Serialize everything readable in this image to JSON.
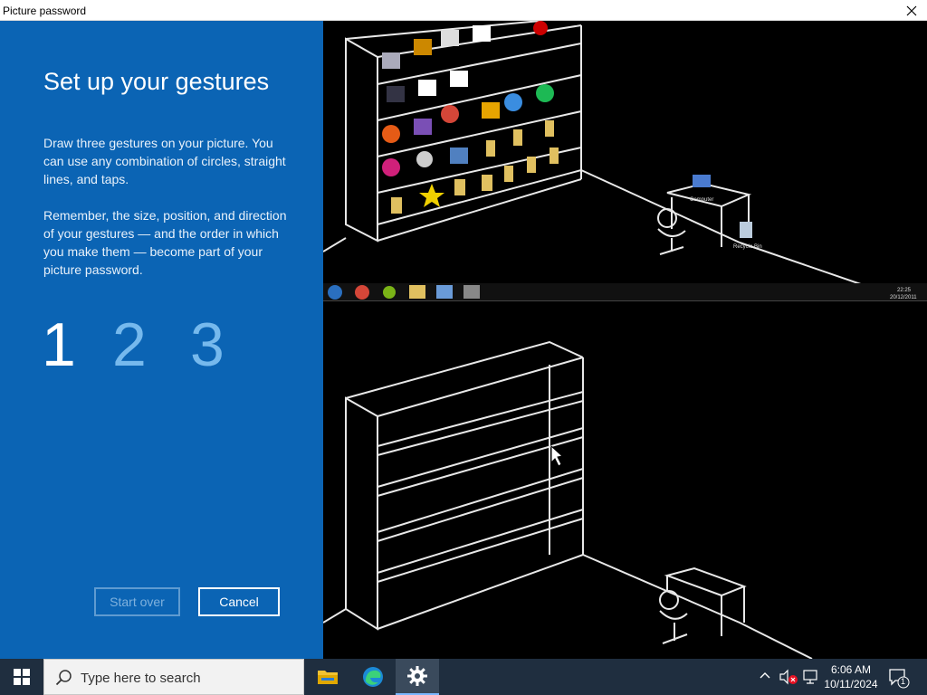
{
  "window": {
    "title": "Picture password"
  },
  "panel": {
    "heading": "Set up your gestures",
    "paragraph1": "Draw three gestures on your picture. You can use any combination of circles, straight lines, and taps.",
    "paragraph2": "Remember, the size, position, and direction of your gestures — and the order in which you make them — become part of your picture password.",
    "steps": [
      "1",
      "2",
      "3"
    ],
    "start_over_label": "Start over",
    "cancel_label": "Cancel"
  },
  "picture": {
    "top_labels": {
      "computer": "Computer",
      "recycle_bin": "Recycle Bin",
      "clock_time": "22:25",
      "clock_date": "20/12/2011"
    }
  },
  "taskbar": {
    "search_placeholder": "Type here to search",
    "apps": [
      "file-explorer-icon",
      "edge-icon",
      "settings-icon"
    ],
    "time": "6:06 AM",
    "date": "10/11/2024",
    "notification_count": "1"
  },
  "colors": {
    "panel_blue": "#0b64b4",
    "step_inactive": "#76b9ed",
    "taskbar": "#1f2e3f"
  }
}
